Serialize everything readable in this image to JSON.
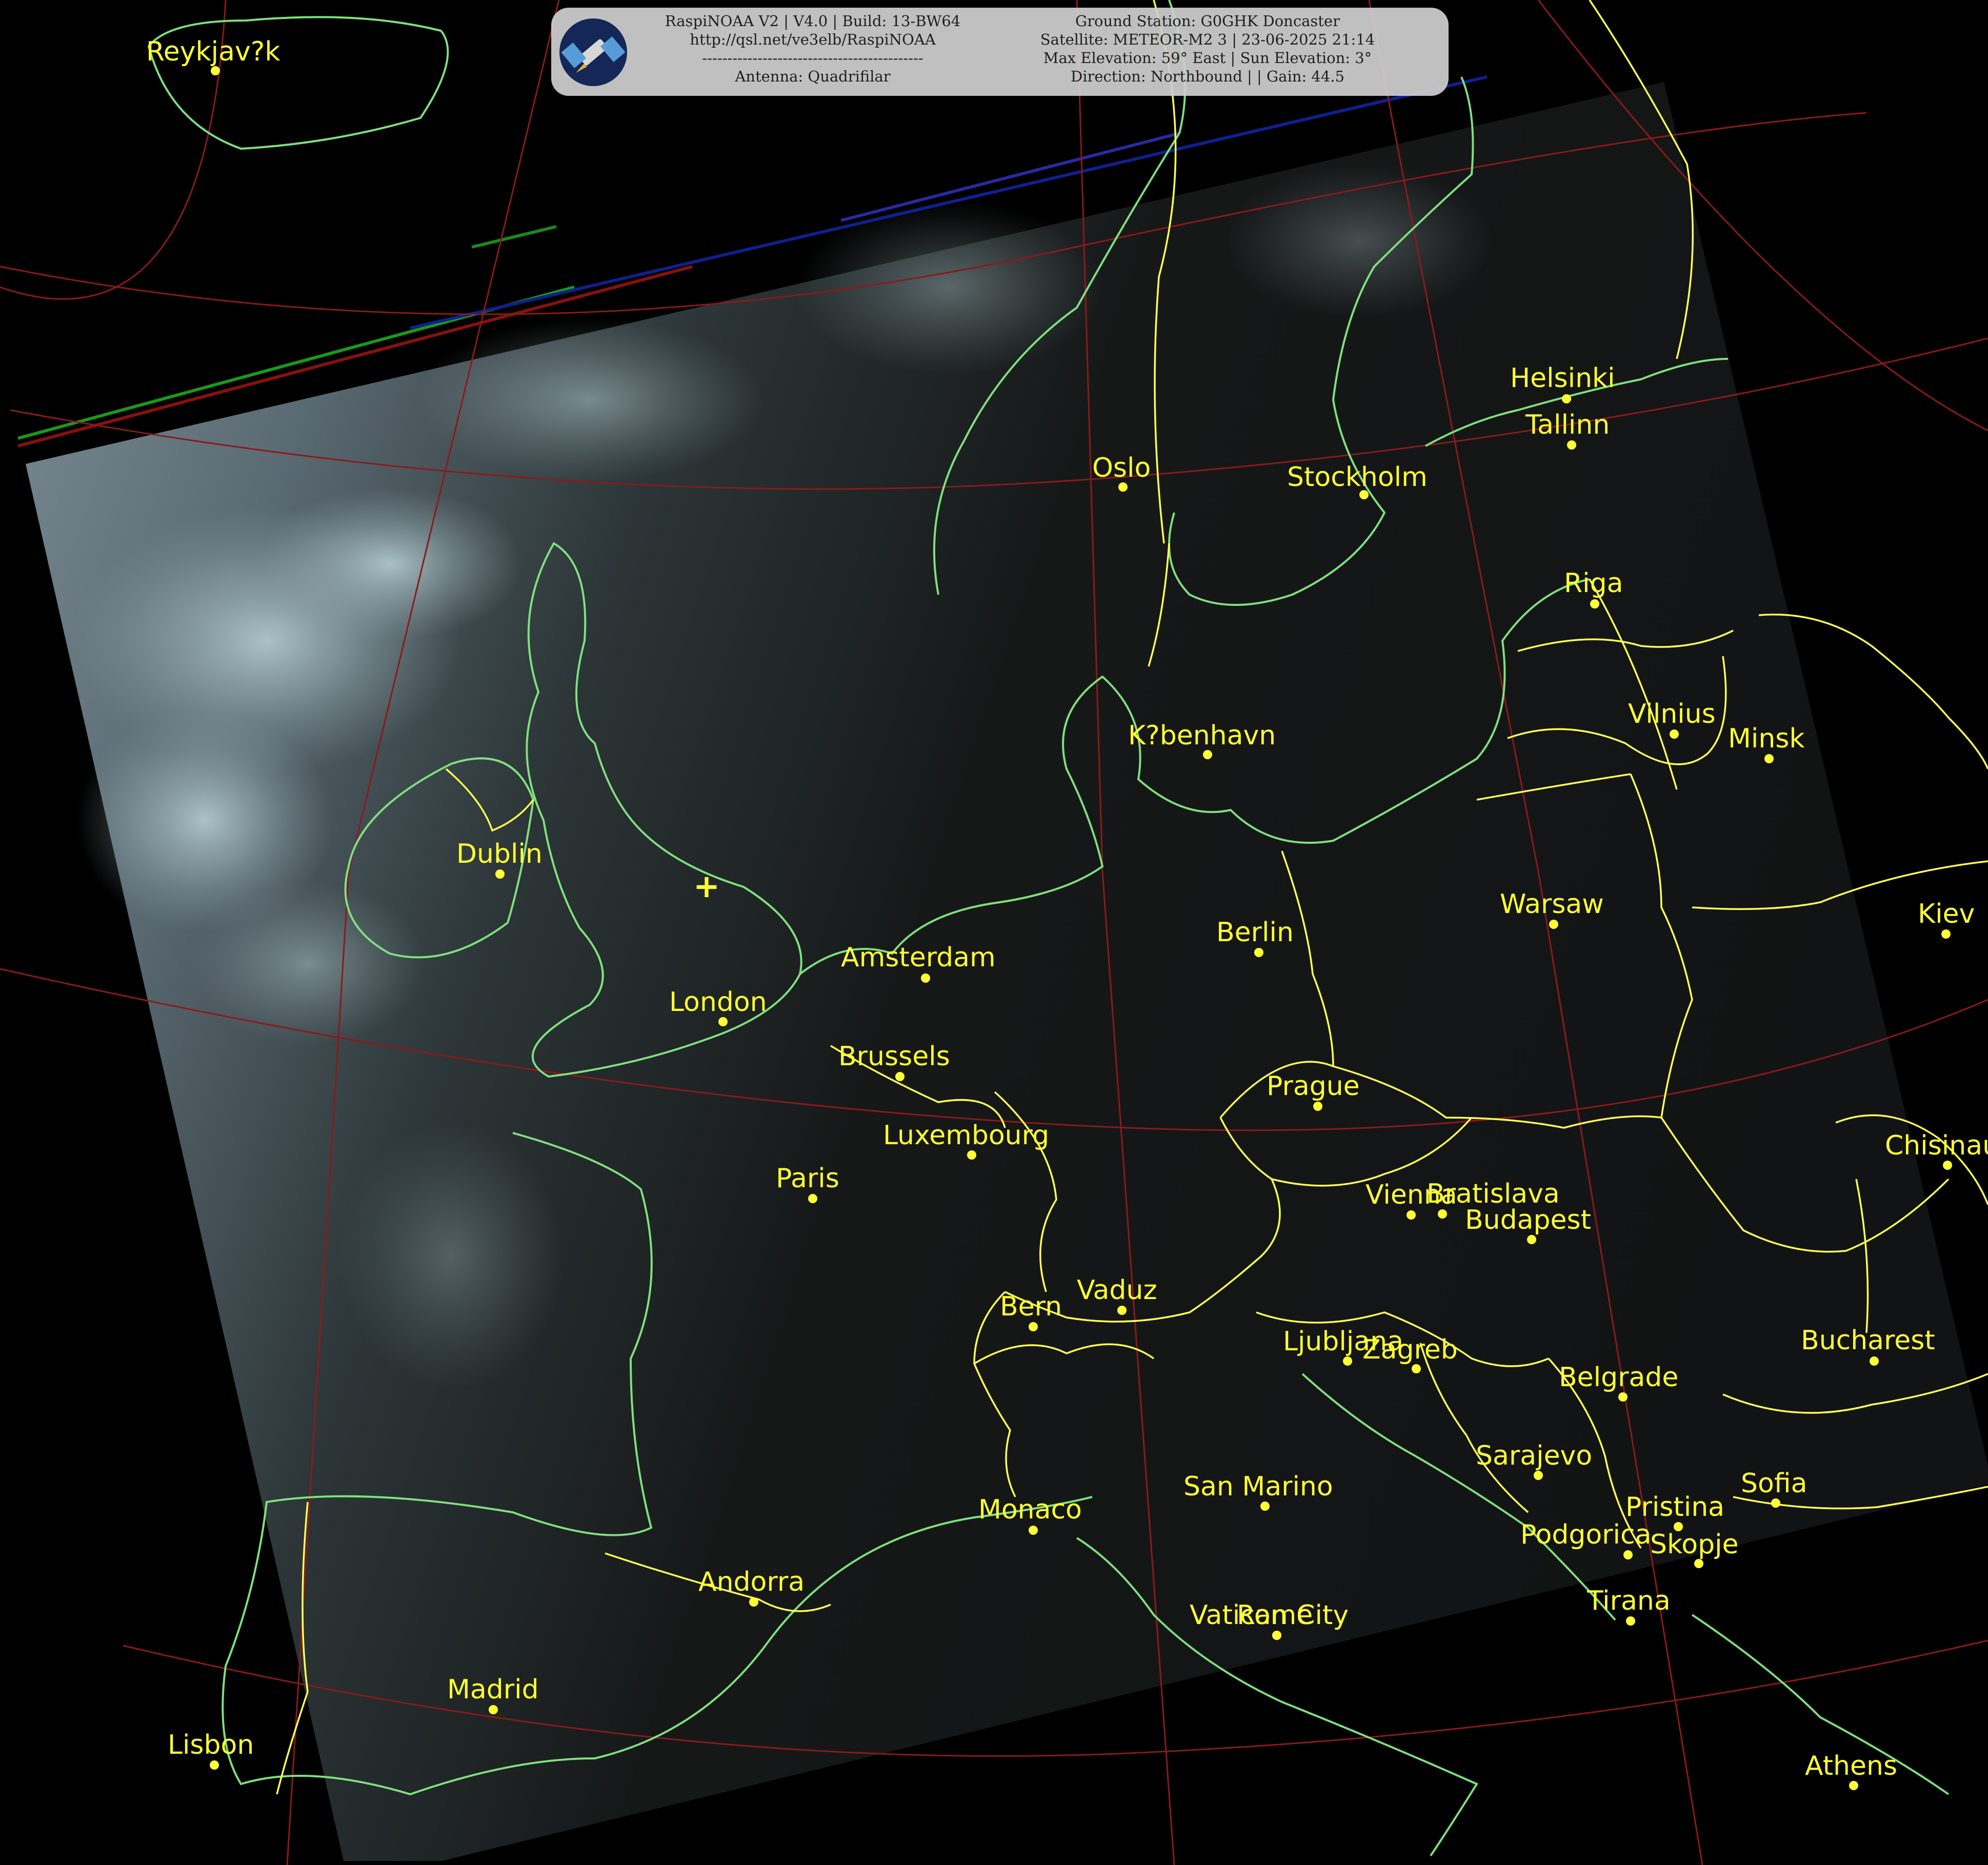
{
  "header": {
    "left_lines": [
      "RaspiNOAA V2 | V4.0 | Build: 13-BW64",
      "http://qsl.net/ve3elb/RaspiNOAA",
      "--------------------------------------------",
      "Antenna: Quadrifilar"
    ],
    "right_lines": [
      "Ground Station: G0GHK Doncaster",
      "Satellite: METEOR-M2 3 | 23-06-2025 21:14",
      "Max Elevation: 59° East | Sun Elevation: 3°",
      "Direction: Northbound | | Gain: 44.5"
    ],
    "logo_icon": "satellite-icon"
  },
  "map": {
    "ground_station_marker": "+",
    "colors": {
      "label": "#ffff33",
      "coastline": "#7fe07f",
      "border": "#ffff55",
      "graticule": "#8b1a1a"
    },
    "cities": [
      {
        "name": "Reykjav?k"
      },
      {
        "name": "Oslo"
      },
      {
        "name": "Stockholm"
      },
      {
        "name": "Helsinki"
      },
      {
        "name": "Tallinn"
      },
      {
        "name": "Riga"
      },
      {
        "name": "Vilnius"
      },
      {
        "name": "Minsk"
      },
      {
        "name": "K?benhavn"
      },
      {
        "name": "Dublin"
      },
      {
        "name": "London"
      },
      {
        "name": "Amsterdam"
      },
      {
        "name": "Brussels"
      },
      {
        "name": "Luxembourg"
      },
      {
        "name": "Paris"
      },
      {
        "name": "Berlin"
      },
      {
        "name": "Warsaw"
      },
      {
        "name": "Kiev"
      },
      {
        "name": "Prague"
      },
      {
        "name": "Vienna"
      },
      {
        "name": "Bratislava"
      },
      {
        "name": "Budapest"
      },
      {
        "name": "Chisinau"
      },
      {
        "name": "Bern"
      },
      {
        "name": "Vaduz"
      },
      {
        "name": "Ljubljana"
      },
      {
        "name": "Zagreb"
      },
      {
        "name": "Belgrade"
      },
      {
        "name": "Bucharest"
      },
      {
        "name": "Sarajevo"
      },
      {
        "name": "Sofia"
      },
      {
        "name": "San Marino"
      },
      {
        "name": "Monaco"
      },
      {
        "name": "Pristina"
      },
      {
        "name": "Podgorica"
      },
      {
        "name": "Skopje"
      },
      {
        "name": "Andorra"
      },
      {
        "name": "Tirana"
      },
      {
        "name": "Vatican City"
      },
      {
        "name": "Rome"
      },
      {
        "name": "Madrid"
      },
      {
        "name": "Lisbon"
      },
      {
        "name": "Athens"
      }
    ]
  }
}
